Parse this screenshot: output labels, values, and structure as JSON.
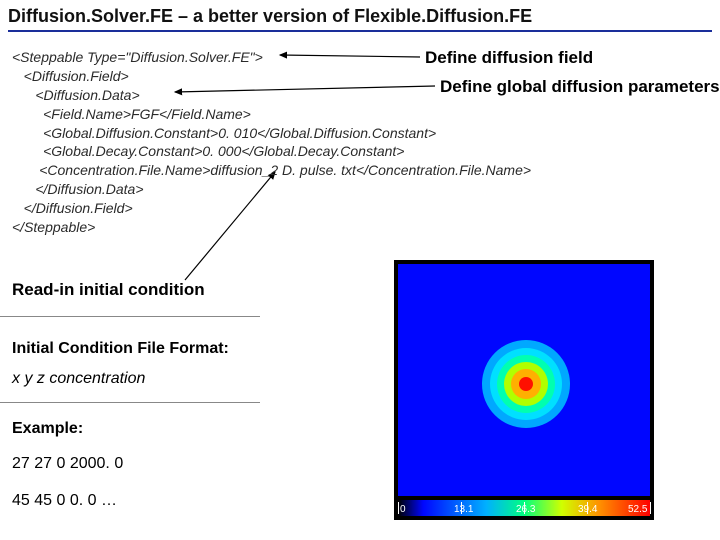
{
  "title": "Diffusion.Solver.FE – a better version of Flexible.Diffusion.FE",
  "annotations": {
    "define_field": "Define diffusion field",
    "define_params": "Define global diffusion parameters",
    "readin": "Read-in initial condition"
  },
  "code": {
    "l1": "<Steppable Type=\"Diffusion.Solver.FE\">",
    "l2": "   <Diffusion.Field>",
    "l3": "      <Diffusion.Data>",
    "l4": "        <Field.Name>FGF</Field.Name>",
    "l5": "        <Global.Diffusion.Constant>0. 010</Global.Diffusion.Constant>",
    "l6": "        <Global.Decay.Constant>0. 000</Global.Decay.Constant>",
    "l7": "       <Concentration.File.Name>diffusion_2 D. pulse. txt</Concentration.File.Name>",
    "l8": "      </Diffusion.Data>",
    "l9": "   </Diffusion.Field>",
    "l10": "</Steppable>"
  },
  "ic": {
    "heading": "Initial Condition File Format:",
    "format": "x y z concentration",
    "example_h": "Example:",
    "example1": "27 27 0 2000. 0",
    "example2": "45 45 0 0. 0 …"
  },
  "chart_data": {
    "type": "heatmap",
    "title": "",
    "xlabel": "",
    "ylabel": "",
    "colorbar": {
      "ticks": [
        0,
        13.1,
        26.3,
        39.4,
        52.5
      ],
      "range": [
        0,
        52.5
      ]
    },
    "hotspot": {
      "cx_frac": 0.5,
      "cy_frac": 0.5,
      "peak_value": 52.5
    },
    "background_value": 0
  }
}
